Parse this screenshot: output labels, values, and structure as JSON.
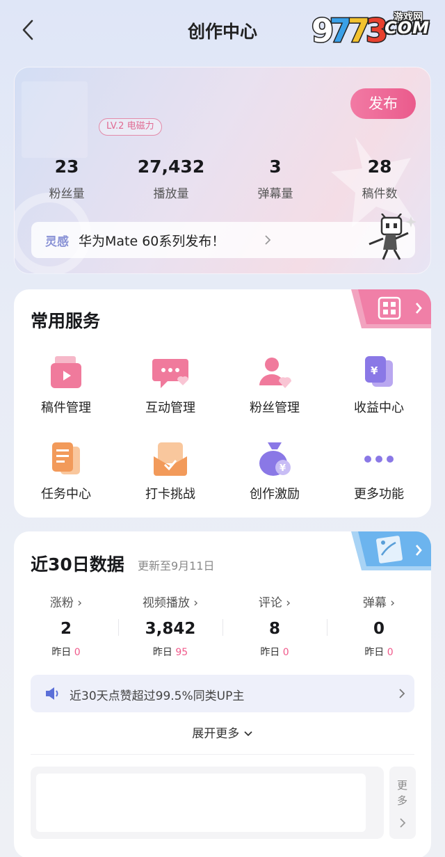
{
  "header": {
    "title": "创作中心"
  },
  "watermark": {
    "brand": "9773",
    "tag": "游戏网",
    "domain": "COM"
  },
  "profile": {
    "publish_label": "发布",
    "level_badge": "LV.2 电磁力",
    "stats": [
      {
        "value": "23",
        "label": "粉丝量"
      },
      {
        "value": "27,432",
        "label": "播放量"
      },
      {
        "value": "3",
        "label": "弹幕量"
      },
      {
        "value": "28",
        "label": "稿件数"
      }
    ],
    "inspiration": {
      "tag": "灵感",
      "text": "华为Mate 60系列发布！"
    }
  },
  "services": {
    "title": "常用服务",
    "items": [
      {
        "label": "稿件管理",
        "icon": "manuscript-icon"
      },
      {
        "label": "互动管理",
        "icon": "chat-bubble-icon"
      },
      {
        "label": "粉丝管理",
        "icon": "fans-icon"
      },
      {
        "label": "收益中心",
        "icon": "revenue-icon"
      },
      {
        "label": "任务中心",
        "icon": "task-icon"
      },
      {
        "label": "打卡挑战",
        "icon": "checkin-icon"
      },
      {
        "label": "创作激励",
        "icon": "money-bag-icon"
      },
      {
        "label": "更多功能",
        "icon": "more-dots-icon"
      }
    ]
  },
  "recent_data": {
    "title": "近30日数据",
    "update_note": "更新至9月11日",
    "metrics": [
      {
        "label": "涨粉 ›",
        "value": "2",
        "yesterday_label": "昨日",
        "yesterday_value": "0"
      },
      {
        "label": "视频播放 ›",
        "value": "3,842",
        "yesterday_label": "昨日",
        "yesterday_value": "95"
      },
      {
        "label": "评论 ›",
        "value": "8",
        "yesterday_label": "昨日",
        "yesterday_value": "0"
      },
      {
        "label": "弹幕 ›",
        "value": "0",
        "yesterday_label": "昨日",
        "yesterday_value": "0"
      }
    ],
    "notice": "近30天点赞超过99.5%同类UP主",
    "expand_label": "展开更多",
    "more_label": "更多"
  },
  "colors": {
    "accent": "#ea5b8c",
    "pink_number": "#f05a8b",
    "inspire_tag": "#8a93d6"
  }
}
